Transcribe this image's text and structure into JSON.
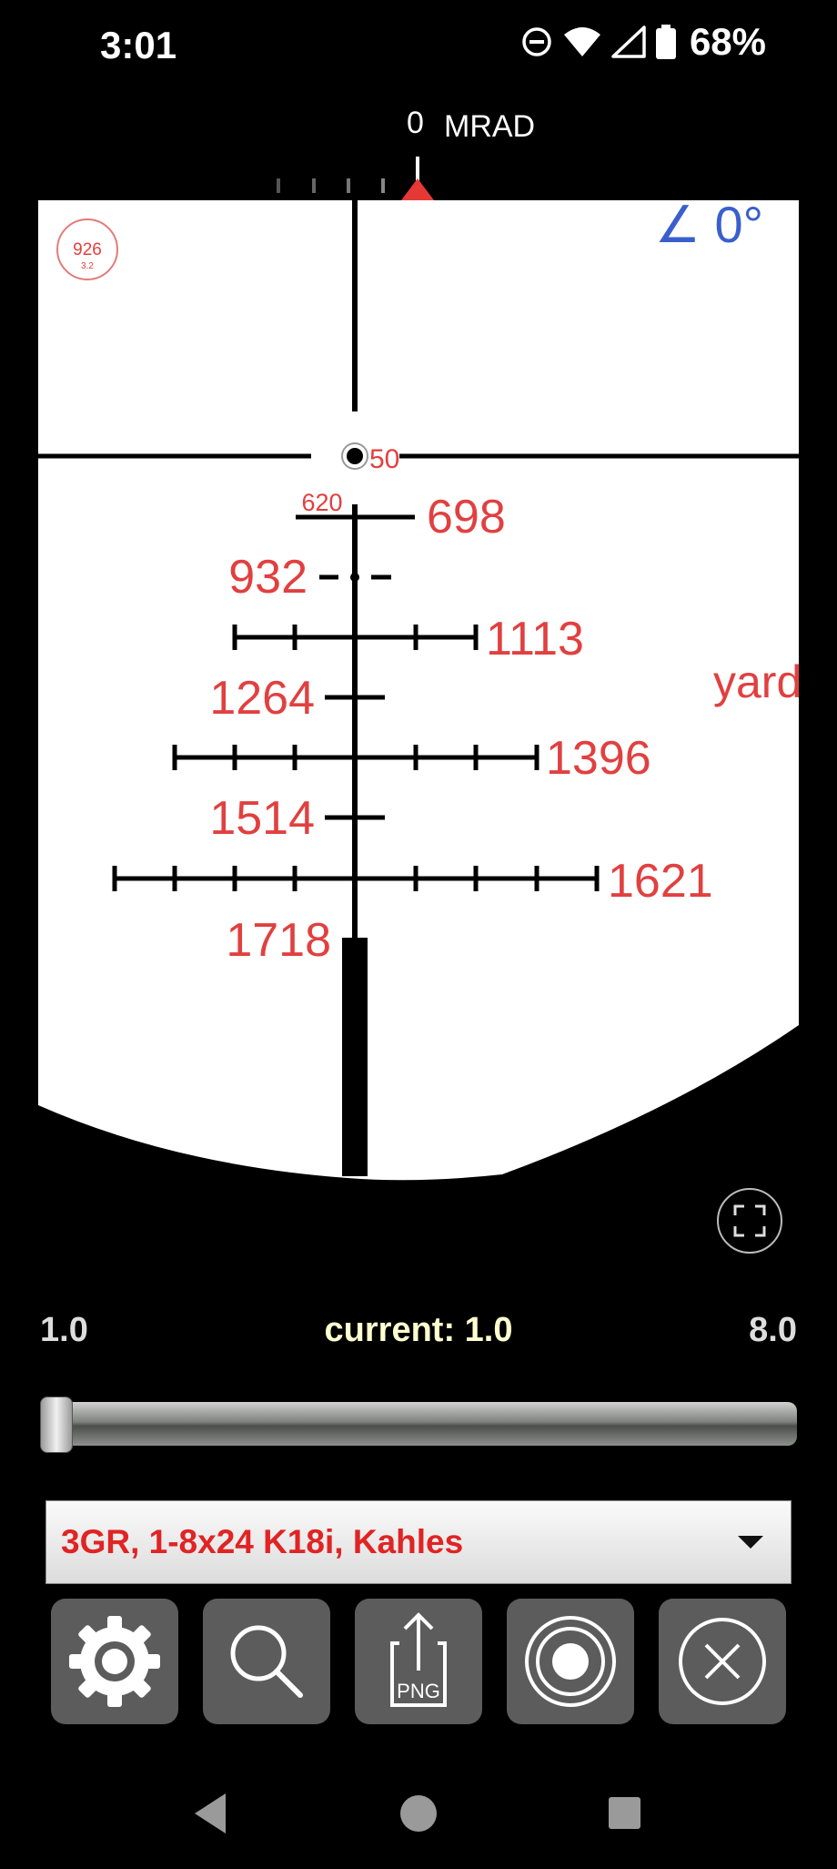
{
  "status_bar": {
    "time": "3:01",
    "battery_percent": "68%",
    "icons": [
      "do-not-disturb-icon",
      "wifi-icon",
      "cell-signal-icon",
      "battery-icon"
    ]
  },
  "mrad_scale": {
    "value": "0",
    "unit": "MRAD"
  },
  "reticle": {
    "badge": {
      "top": "926",
      "bottom": "3.2"
    },
    "cant_angle": "∠ 0°",
    "center_label": "50",
    "offscreen_label": "yard",
    "drop_labels": [
      {
        "value": "620",
        "row": 1,
        "size": "small"
      },
      {
        "value": "698",
        "row": 1,
        "side": "right"
      },
      {
        "value": "932",
        "row": 2,
        "side": "left"
      },
      {
        "value": "1113",
        "row": 3,
        "side": "right"
      },
      {
        "value": "1264",
        "row": 4,
        "side": "left"
      },
      {
        "value": "1396",
        "row": 5,
        "side": "right"
      },
      {
        "value": "1514",
        "row": 6,
        "side": "left"
      },
      {
        "value": "1621",
        "row": 7,
        "side": "right"
      },
      {
        "value": "1718",
        "row": 8,
        "side": "left"
      }
    ],
    "colors": {
      "background": "#ffffff",
      "lines": "#000000",
      "labels": "#e14040",
      "cant": "#3a5fcd"
    }
  },
  "magnification": {
    "min": "1.0",
    "current_label": "current: 1.0",
    "max": "8.0",
    "current_fraction": 0.0
  },
  "scope_select": {
    "value": "3GR, 1-8x24 K18i, Kahles"
  },
  "toolbar": {
    "buttons": [
      "settings-icon",
      "search-icon",
      "export-png-icon",
      "target-icon",
      "close-icon"
    ],
    "png_label": "PNG"
  }
}
